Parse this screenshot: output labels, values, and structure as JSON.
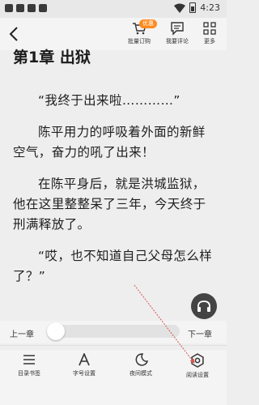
{
  "status_bar": {
    "time": "4:23"
  },
  "toolbar": {
    "badge": "优惠",
    "batch_order_label": "批量订购",
    "my_comment_label": "我要评论",
    "more_label": "更多"
  },
  "chapter": {
    "title": "第1章 出狱",
    "paragraphs": [
      "“我终于出来啦…………”",
      "陈平用力的呼吸着外面的新鲜空气，奋力的吼了出来！",
      "在陈平身后，就是洪城监狱，他在这里整整呆了三年，今天终于刑满释放了。",
      "“哎，也不知道自己父母怎么样了？”"
    ]
  },
  "progress": {
    "prev_label": "上一章",
    "next_label": "下一章",
    "value": 0
  },
  "bottom_nav": {
    "items": [
      {
        "label": "目录书签",
        "icon": "list-icon"
      },
      {
        "label": "字号设置",
        "icon": "font-size-icon"
      },
      {
        "label": "夜间模式",
        "icon": "moon-icon"
      },
      {
        "label": "阅读设置",
        "icon": "settings-gear-icon"
      }
    ]
  },
  "colors": {
    "accent": "#ff8a1f",
    "annotation": "#d9534f"
  }
}
